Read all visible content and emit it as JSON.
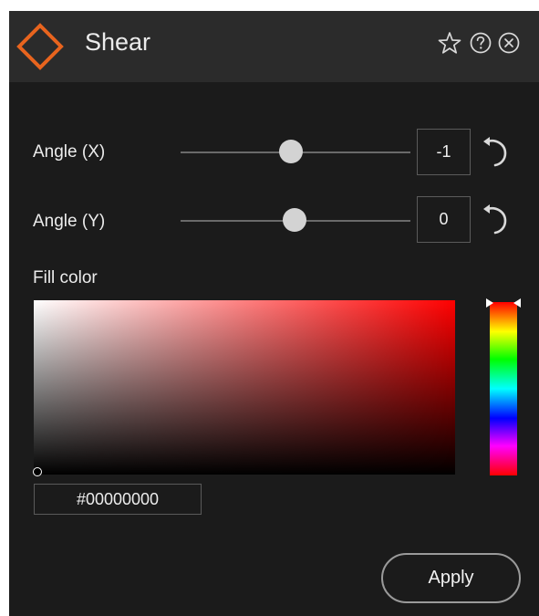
{
  "dialog": {
    "title": "Shear",
    "accent_color": "#e8641e",
    "header_icons": [
      "star-icon",
      "help-icon",
      "close-icon"
    ]
  },
  "controls": {
    "angle_x": {
      "label": "Angle (X)",
      "value": "-1",
      "slider_fraction": 0.49
    },
    "angle_y": {
      "label": "Angle (Y)",
      "value": "0",
      "slider_fraction": 0.5
    }
  },
  "fill": {
    "label": "Fill color",
    "hex_value": "#00000000",
    "hue_color": "#ff0000"
  },
  "footer": {
    "apply_label": "Apply"
  }
}
